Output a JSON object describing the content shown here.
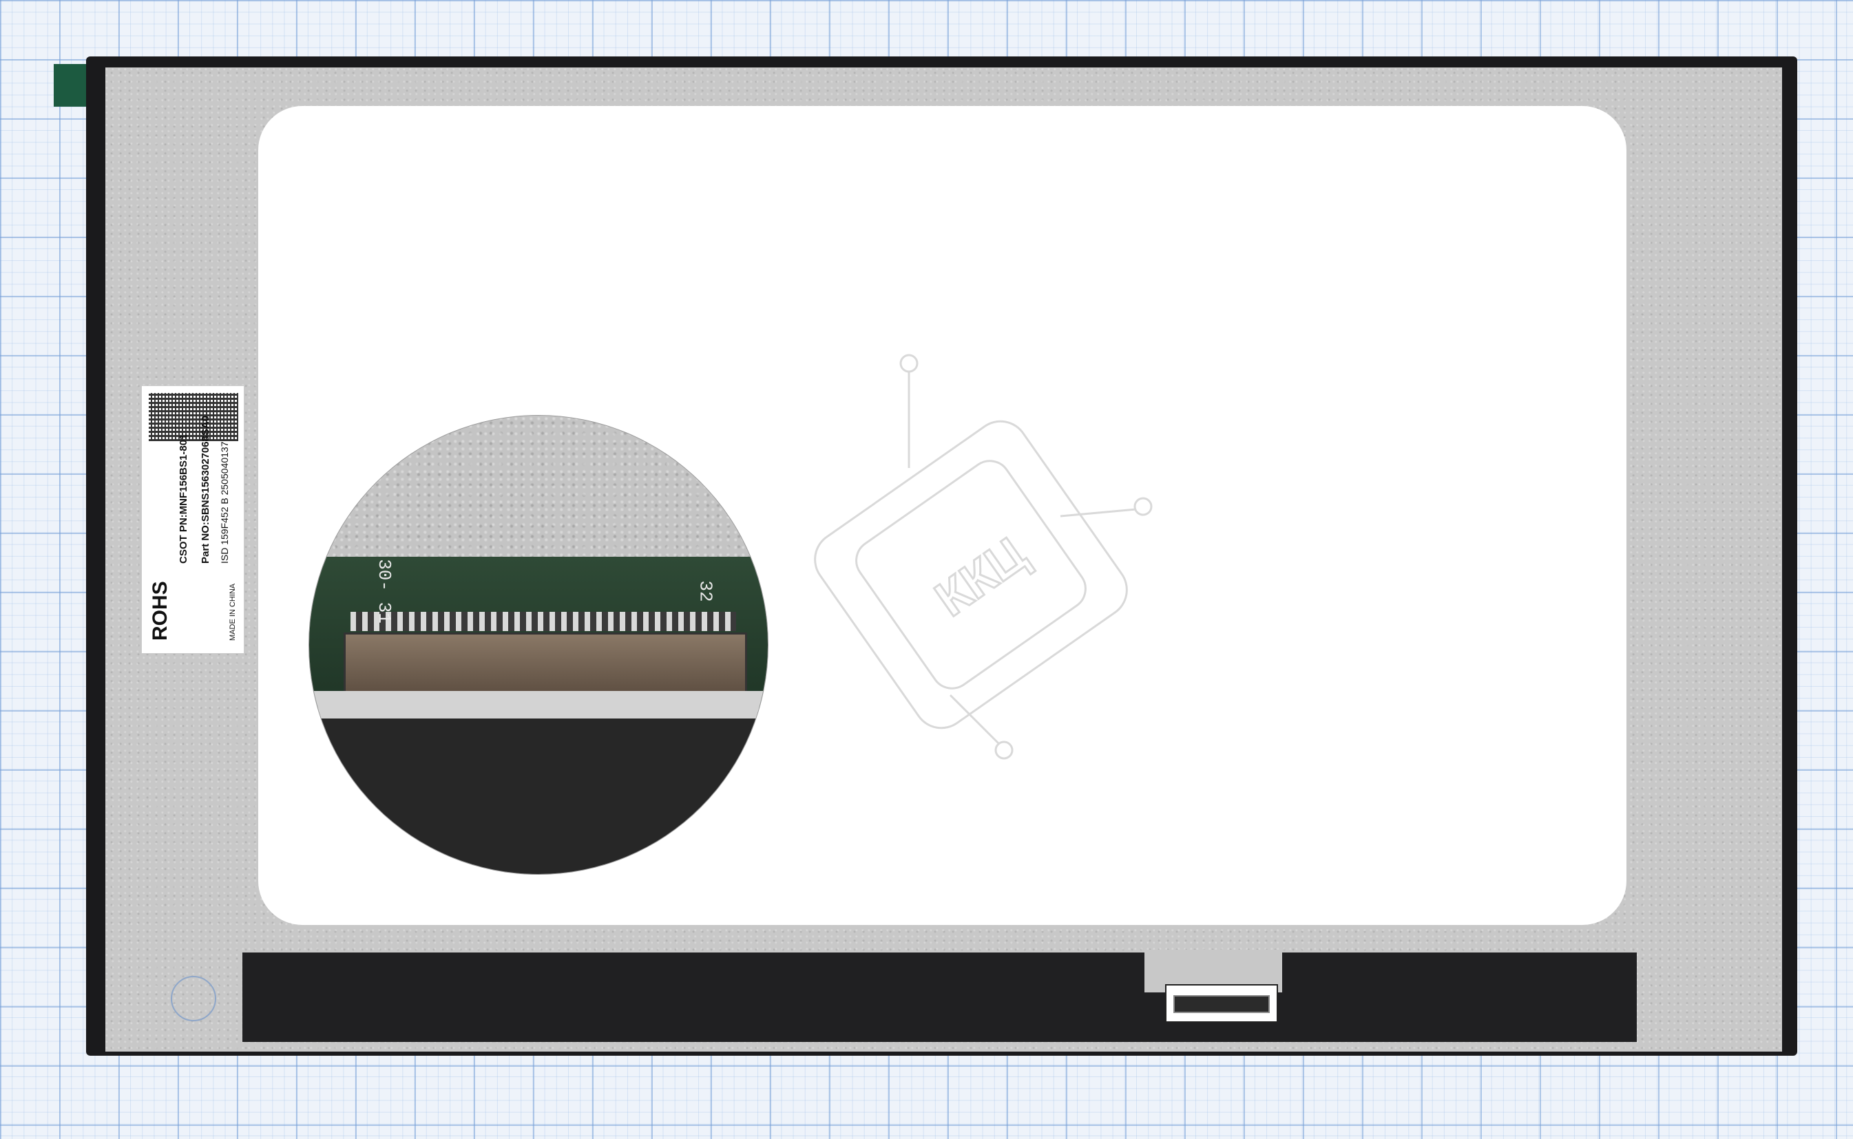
{
  "panel": {
    "label": {
      "rohs": "ROHS",
      "csot_pn": "CSOT PN:MNF156BS1-801",
      "part_no": "Part NO:SBNS1563027068SA0",
      "serial": "ISD 159F452 B 2505040137",
      "made_in": "MADE IN CHINA"
    },
    "zoom": {
      "pin_left": "30-\n31",
      "pin_right": "32"
    },
    "watermark": {
      "text": "ККЦ"
    }
  }
}
